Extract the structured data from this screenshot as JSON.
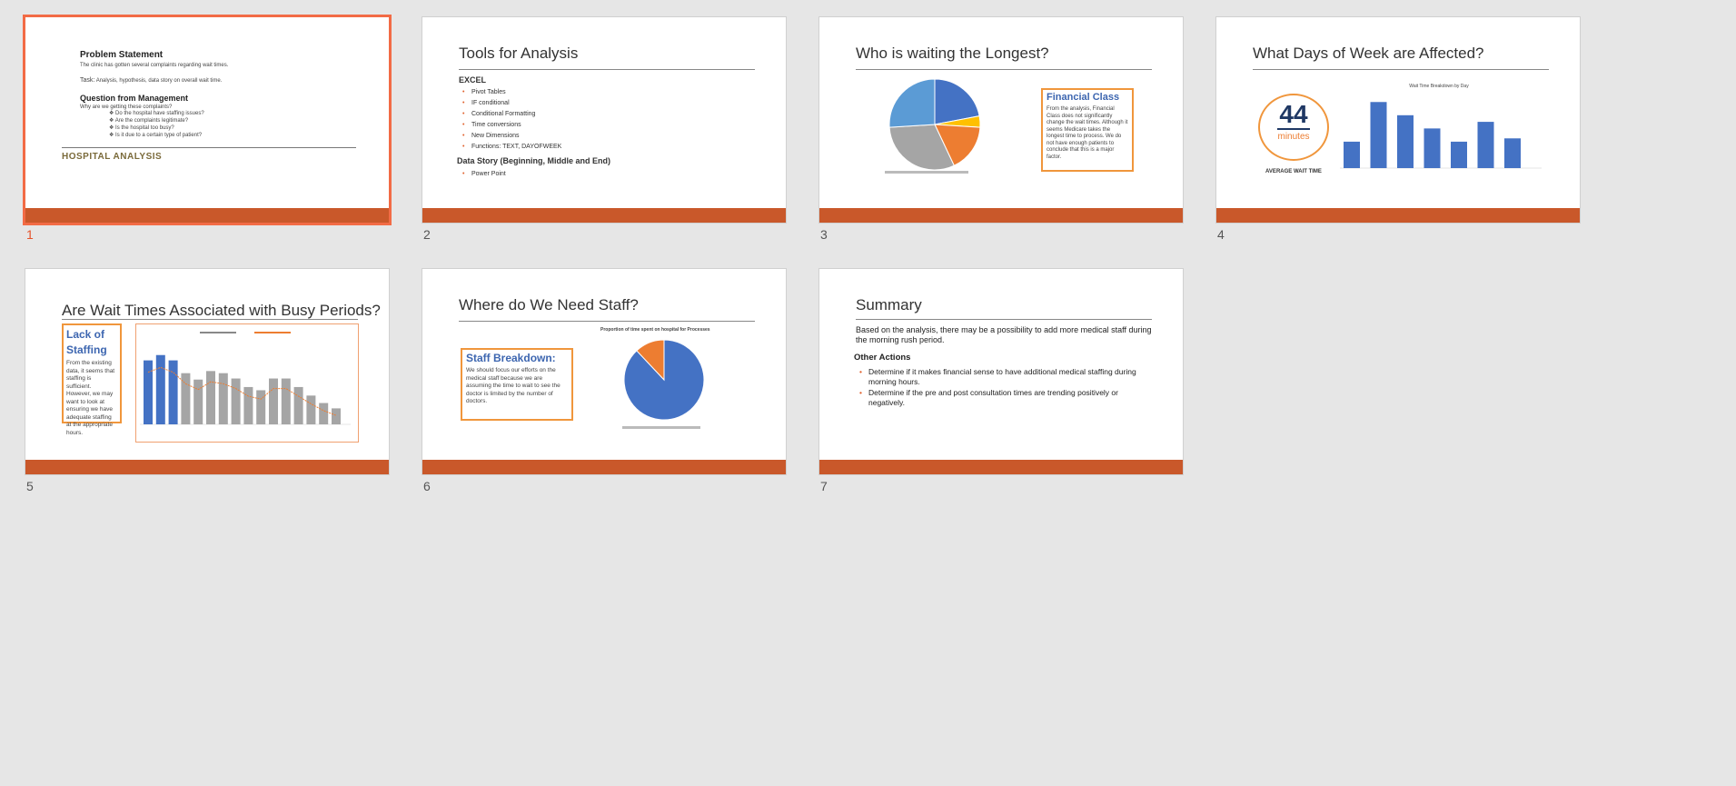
{
  "slides": [
    {
      "number": "1",
      "h1": "Problem Statement",
      "p1": "The clinic has gotten several complaints regarding wait times.",
      "task_label": "Task:",
      "task": "Analysis, hypothesis, data story on overall wait time.",
      "h2": "Question from Management",
      "p2": "Why are we getting these complaints?",
      "questions": [
        "Do the hospital have staffing issues?",
        "Are the complaints legitimate?",
        "Is the hospital too busy?",
        "Is it due to a certain type of patient?"
      ],
      "footer_title": "HOSPITAL ANALYSIS"
    },
    {
      "number": "2",
      "title": "Tools for Analysis",
      "section1": "EXCEL",
      "items1": [
        "Pivot Tables",
        "IF conditional",
        "Conditional Formatting",
        "Time conversions",
        "New Dimensions",
        "Functions: TEXT, DAYOFWEEK"
      ],
      "section2": "Data Story (Beginning, Middle and End)",
      "items2": [
        "Power Point"
      ]
    },
    {
      "number": "3",
      "title": "Who is waiting the Longest?",
      "box_title": "Financial Class",
      "box_text": "From the analysis, Financial Class does not significantly change the wait times. Although it seems Medicare takes the longest time to process. We do not have enough patients to conclude that this is a major factor."
    },
    {
      "number": "4",
      "title": "What Days of Week are Affected?",
      "big_number": "44",
      "big_unit": "minutes",
      "caption": "AVERAGE WAIT TIME",
      "chart_title": "Wait Time Breakdown by Day"
    },
    {
      "number": "5",
      "title": "Are Wait Times Associated with Busy Periods?",
      "box_title": "Lack of Staffing",
      "box_text": "From the existing data, it seems that staffing is sufficient. However, we may want to look at ensuring we have adequate staffing at the appropriate hours."
    },
    {
      "number": "6",
      "title": "Where do We Need Staff?",
      "box_title": "Staff Breakdown:",
      "box_text": "We should focus our efforts on the medical staff because we are assuming the time to wait to see the doctor is limited by the number of doctors.",
      "chart_title": "Proportion of time spent on hospital for Processes"
    },
    {
      "number": "7",
      "title": "Summary",
      "body": "Based on the analysis, there may be a possibility to add more medical staff during the morning rush period.",
      "subhead": "Other Actions",
      "items": [
        "Determine if it makes financial sense to have additional medical staffing during morning hours.",
        "Determine if the pre and post consultation times are trending positively or negatively."
      ]
    }
  ],
  "colors": {
    "accent_band": "#c9582a",
    "selection": "#f26b45",
    "chart_blue": "#4472c4",
    "chart_orange": "#ed7d31",
    "chart_gray": "#a5a5a5",
    "text_blue": "#3d66b0"
  },
  "chart_data": [
    {
      "type": "pie",
      "slide": 3,
      "values": [
        22,
        4,
        17,
        31,
        26
      ],
      "colors": [
        "#4472c4",
        "#ffc000",
        "#ed7d31",
        "#a5a5a5",
        "#5b9bd5"
      ]
    },
    {
      "type": "bar",
      "slide": 4,
      "title": "Wait Time Breakdown by Day",
      "values": [
        40,
        100,
        80,
        60,
        40,
        70,
        45
      ],
      "ylim": [
        0,
        110
      ]
    },
    {
      "type": "bar",
      "slide": 5,
      "values": [
        60,
        65,
        60,
        48,
        42,
        50,
        48,
        43,
        35,
        32,
        43,
        43,
        35,
        27,
        20,
        15
      ],
      "highlight_first": 3,
      "ylim": [
        0,
        75
      ]
    },
    {
      "type": "pie",
      "slide": 6,
      "title": "Proportion of time spent on hospital for Processes",
      "values": [
        88,
        12
      ],
      "colors": [
        "#4472c4",
        "#ed7d31"
      ]
    }
  ]
}
